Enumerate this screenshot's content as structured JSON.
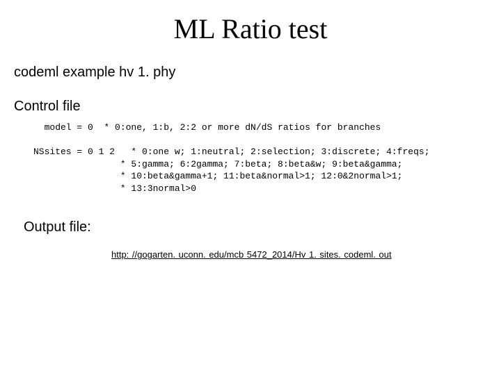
{
  "title": "ML Ratio test",
  "example_label": "codeml example hv 1. phy",
  "control_label": "Control file",
  "code_block": "  model = 0  * 0:one, 1:b, 2:2 or more dN/dS ratios for branches\n\nNSsites = 0 1 2   * 0:one w; 1:neutral; 2:selection; 3:discrete; 4:freqs;\n                * 5:gamma; 6:2gamma; 7:beta; 8:beta&w; 9:beta&gamma;\n                * 10:beta&gamma+1; 11:beta&normal>1; 12:0&2normal>1;\n                * 13:3normal>0",
  "output_label": "Output file:",
  "link_text": "http: //gogarten. uconn. edu/mcb 5472_2014/Hv 1. sites. codeml. out"
}
